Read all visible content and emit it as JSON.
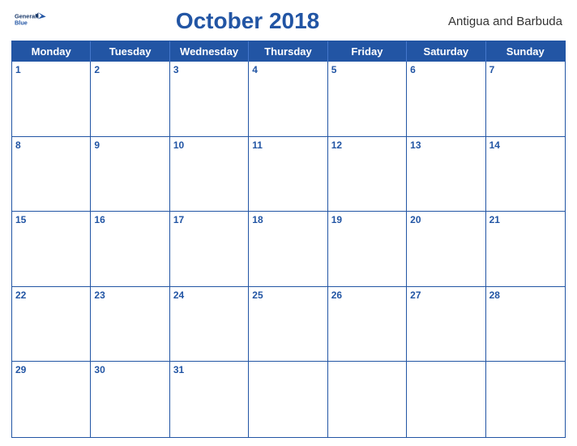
{
  "header": {
    "logo_line1": "General",
    "logo_line2": "Blue",
    "month_title": "October 2018",
    "country": "Antigua and Barbuda"
  },
  "days_of_week": [
    "Monday",
    "Tuesday",
    "Wednesday",
    "Thursday",
    "Friday",
    "Saturday",
    "Sunday"
  ],
  "weeks": [
    [
      {
        "day": 1,
        "empty": false
      },
      {
        "day": 2,
        "empty": false
      },
      {
        "day": 3,
        "empty": false
      },
      {
        "day": 4,
        "empty": false
      },
      {
        "day": 5,
        "empty": false
      },
      {
        "day": 6,
        "empty": false
      },
      {
        "day": 7,
        "empty": false
      }
    ],
    [
      {
        "day": 8,
        "empty": false
      },
      {
        "day": 9,
        "empty": false
      },
      {
        "day": 10,
        "empty": false
      },
      {
        "day": 11,
        "empty": false
      },
      {
        "day": 12,
        "empty": false
      },
      {
        "day": 13,
        "empty": false
      },
      {
        "day": 14,
        "empty": false
      }
    ],
    [
      {
        "day": 15,
        "empty": false
      },
      {
        "day": 16,
        "empty": false
      },
      {
        "day": 17,
        "empty": false
      },
      {
        "day": 18,
        "empty": false
      },
      {
        "day": 19,
        "empty": false
      },
      {
        "day": 20,
        "empty": false
      },
      {
        "day": 21,
        "empty": false
      }
    ],
    [
      {
        "day": 22,
        "empty": false
      },
      {
        "day": 23,
        "empty": false
      },
      {
        "day": 24,
        "empty": false
      },
      {
        "day": 25,
        "empty": false
      },
      {
        "day": 26,
        "empty": false
      },
      {
        "day": 27,
        "empty": false
      },
      {
        "day": 28,
        "empty": false
      }
    ],
    [
      {
        "day": 29,
        "empty": false
      },
      {
        "day": 30,
        "empty": false
      },
      {
        "day": 31,
        "empty": false
      },
      {
        "day": null,
        "empty": true
      },
      {
        "day": null,
        "empty": true
      },
      {
        "day": null,
        "empty": true
      },
      {
        "day": null,
        "empty": true
      }
    ]
  ],
  "colors": {
    "primary": "#2255a4",
    "header_bg": "#2255a4",
    "header_text": "#ffffff",
    "border": "#2255a4"
  }
}
